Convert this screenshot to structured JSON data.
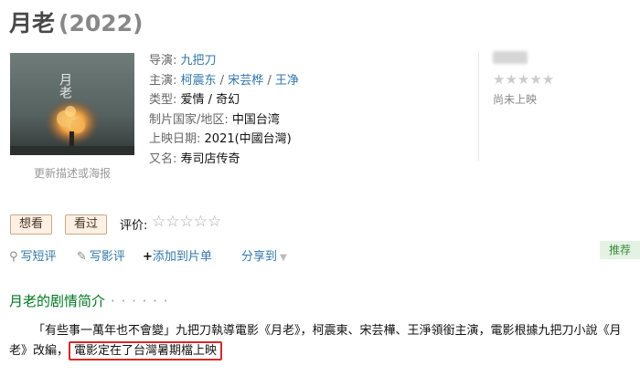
{
  "title": {
    "name": "月老",
    "year": "(2022)"
  },
  "poster": {
    "link_text": "更新描述或海报",
    "art_text": "月老"
  },
  "info": {
    "director_label": "导演:",
    "director": "九把刀",
    "cast_label": "主演:",
    "cast": [
      "柯震东",
      "宋芸桦",
      "王净"
    ],
    "cast_sep": " / ",
    "genre_label": "类型:",
    "genre": "爱情 / 奇幻",
    "region_label": "制片国家/地区:",
    "region": "中国台湾",
    "release_label": "上映日期:",
    "release": "2021(中國台灣)",
    "aka_label": "又名:",
    "aka": "寿司店传奇"
  },
  "rating": {
    "stars": "★★★★★",
    "status": "尚未上映"
  },
  "actions": {
    "want": "想看",
    "seen": "看过",
    "rate_label": "评价:",
    "rate_stars": "☆☆☆☆☆",
    "short_review_icon": "⚲",
    "short_review": "写短评",
    "review_icon": "✎",
    "review": "写影评",
    "add_to_list_icon": "+",
    "add_to_list": "添加到片单",
    "share": "分享到",
    "share_arrow": "▼",
    "recommend": "推荐"
  },
  "synopsis": {
    "title": "月老的剧情简介",
    "dots": "· · · · · ·",
    "text": "「有些事一萬年也不會變」九把刀執導電影《月老》，柯震東、宋芸樺、王淨領銜主演，電影根據九把刀小說《月老》改編，",
    "highlight": "電影定在了台灣暑期檔上映"
  },
  "colors": {
    "link": "#3377aa",
    "section_green": "#007722",
    "highlight_red": "#d7272b",
    "button_bg": "#fdf0e4"
  },
  "icons": {
    "short_review": "speech-pin-icon",
    "review": "pencil-icon",
    "add": "plus-icon",
    "share": "chevron-down-icon"
  }
}
